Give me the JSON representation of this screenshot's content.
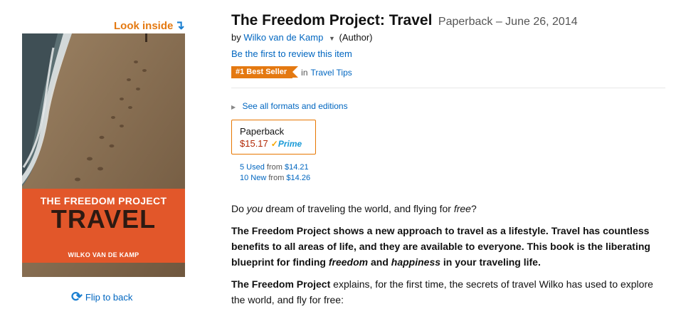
{
  "look_inside": {
    "label": "Look inside",
    "arrow_icon": "↴"
  },
  "cover": {
    "title_line1": "THE FREEDOM PROJECT",
    "title_line2": "TRAVEL",
    "author": "WILKO VAN DE KAMP",
    "band_color": "#e2572a"
  },
  "flip": {
    "label": "Flip to back",
    "icon": "rotate-arrows-icon"
  },
  "product": {
    "title": "The Freedom Project: Travel",
    "format_date": "Paperback – June 26, 2014",
    "by": "by",
    "author": "Wilko van de Kamp",
    "role": "(Author)",
    "review_link": "Be the first to review this item",
    "badge": "#1 Best Seller",
    "badge_in": "in",
    "badge_category": "Travel Tips",
    "see_formats": "See all formats and editions"
  },
  "swatch": {
    "label": "Paperback",
    "price": "$15.17",
    "prime": "Prime"
  },
  "offers": [
    {
      "link": "5 Used",
      "text": "from",
      "price": "$14.21"
    },
    {
      "link": "10 New",
      "text": "from",
      "price": "$14.26"
    }
  ],
  "description": {
    "p1_a": "Do ",
    "p1_b": "you",
    "p1_c": " dream of traveling the world, and flying for ",
    "p1_d": "free",
    "p1_e": "?",
    "p2_a": "The Freedom Project shows a new approach to travel as a lifestyle. Travel has countless benefits to all areas of life, and they are available to everyone. This book is the liberating blueprint for finding ",
    "p2_b": "freedom",
    "p2_c": " and ",
    "p2_d": "happiness",
    "p2_e": " in your traveling life.",
    "p3_a": "The Freedom Project",
    "p3_b": " explains, for the first time, the secrets of travel Wilko has used to explore the world, and fly for free:"
  },
  "colors": {
    "link": "#0066c0",
    "badge": "#e47911",
    "price": "#b12704",
    "prime": "#1a9bd7"
  }
}
